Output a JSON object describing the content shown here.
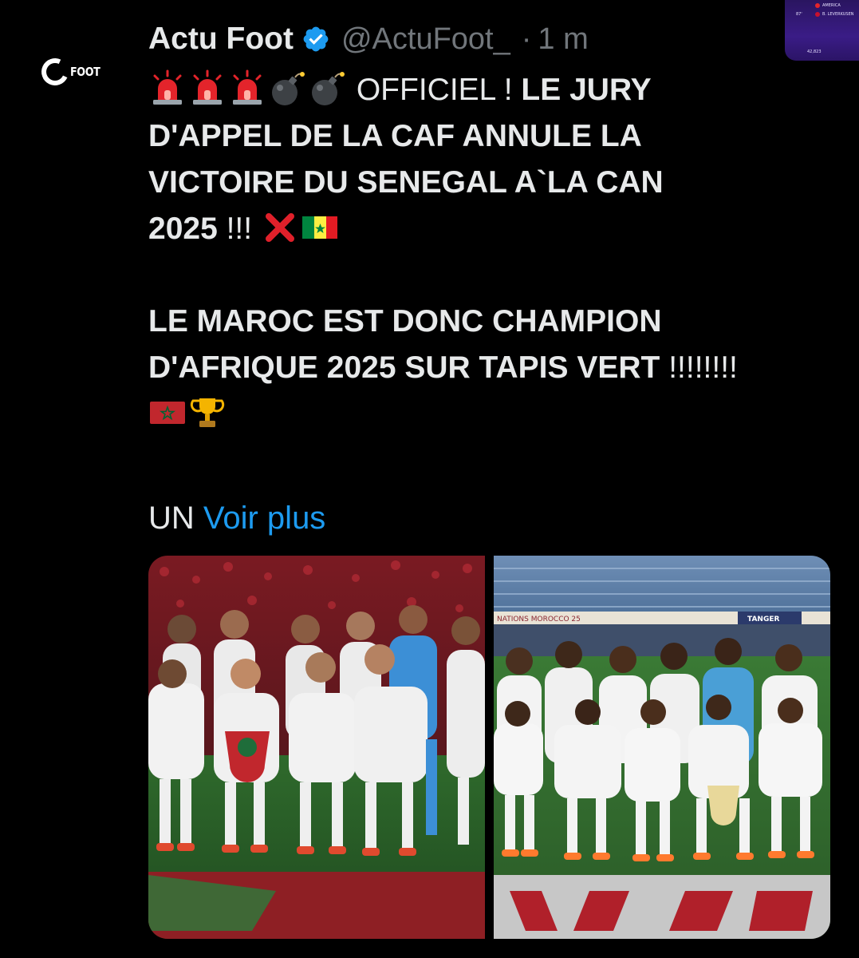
{
  "author": {
    "name": "Actu Foot",
    "handle": "@ActuFoot_",
    "time": "1 m",
    "separator": "·",
    "avatar_text": "FOOT"
  },
  "tweet": {
    "line1_normal": "OFFICIEL ! ",
    "line1_bold": "LE JURY",
    "line2": "D'APPEL DE LA CAF ANNULE LA",
    "line3": "VICTOIRE DU SENEGAL A`LA CAN",
    "line4_bold": "2025",
    "line4_normal": " !!! ",
    "line5": "LE MAROC EST DONC CHAMPION",
    "line6_bold": "D'AFRIQUE 2025 SUR TAPIS VERT",
    "line6_normal": " !!!!!!!!",
    "more_prefix": "UN ",
    "more_link": "Voir plus"
  },
  "media": {
    "left": {
      "icon": "photo-morocco-team"
    },
    "right": {
      "icon": "photo-senegal-team",
      "banner_left": "NATIONS MOROCCO 25",
      "banner_right": "TANGER"
    }
  },
  "widget": {
    "row1": "AMERICA",
    "row2_left": "87'",
    "row2_right": "B. LEVERKUSEN",
    "row3": "42,823"
  },
  "colors": {
    "background": "#000000",
    "text": "#e7e9ea",
    "muted": "#71767b",
    "link": "#1d9bf0",
    "verified": "#1d9bf0"
  }
}
